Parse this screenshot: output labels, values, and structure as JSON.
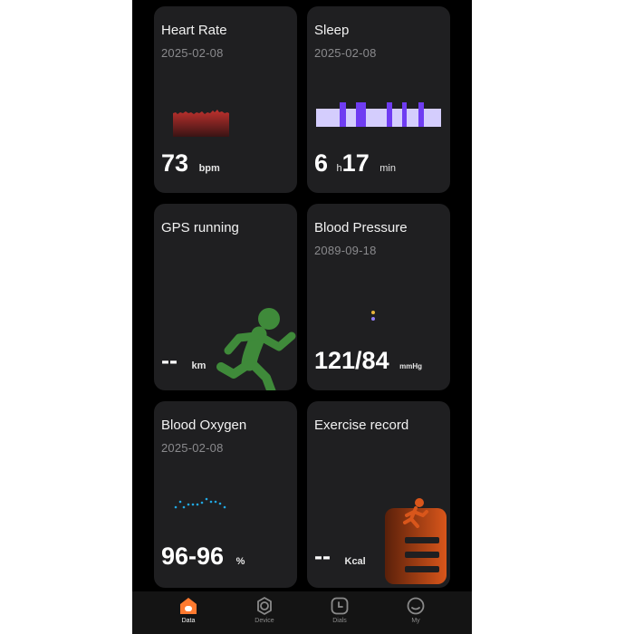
{
  "cards": {
    "heart_rate": {
      "title": "Heart Rate",
      "date": "2025-02-08",
      "value": "73",
      "unit": "bpm"
    },
    "sleep": {
      "title": "Sleep",
      "date": "2025-02-08",
      "hours": "6",
      "hours_unit": "h",
      "minutes": "17",
      "minutes_unit": "min"
    },
    "gps": {
      "title": "GPS running",
      "value": "--",
      "unit": "km"
    },
    "blood_pressure": {
      "title": "Blood Pressure",
      "date": "2089-09-18",
      "value": "121/84",
      "unit": "mmHg"
    },
    "blood_oxygen": {
      "title": "Blood Oxygen",
      "date": "2025-02-08",
      "value": "96-96",
      "unit": "%"
    },
    "exercise": {
      "title": "Exercise record",
      "value": "--",
      "unit": "Kcal"
    }
  },
  "nav": {
    "items": [
      {
        "label": "Data",
        "icon": "home-icon",
        "active": true
      },
      {
        "label": "Device",
        "icon": "watch-icon",
        "active": false
      },
      {
        "label": "Dials",
        "icon": "clock-icon",
        "active": false
      },
      {
        "label": "My",
        "icon": "profile-icon",
        "active": false
      }
    ]
  },
  "colors": {
    "background": "#000000",
    "card": "#1f1f21",
    "heart": "#c0322e",
    "sleep_light": "#d4cdfd",
    "sleep_deep": "#6f3cf2",
    "oxygen": "#21a8e3",
    "runner": "#3f8a3a",
    "exercise": "#d9561b",
    "accent_home": "#ff7a2f"
  }
}
